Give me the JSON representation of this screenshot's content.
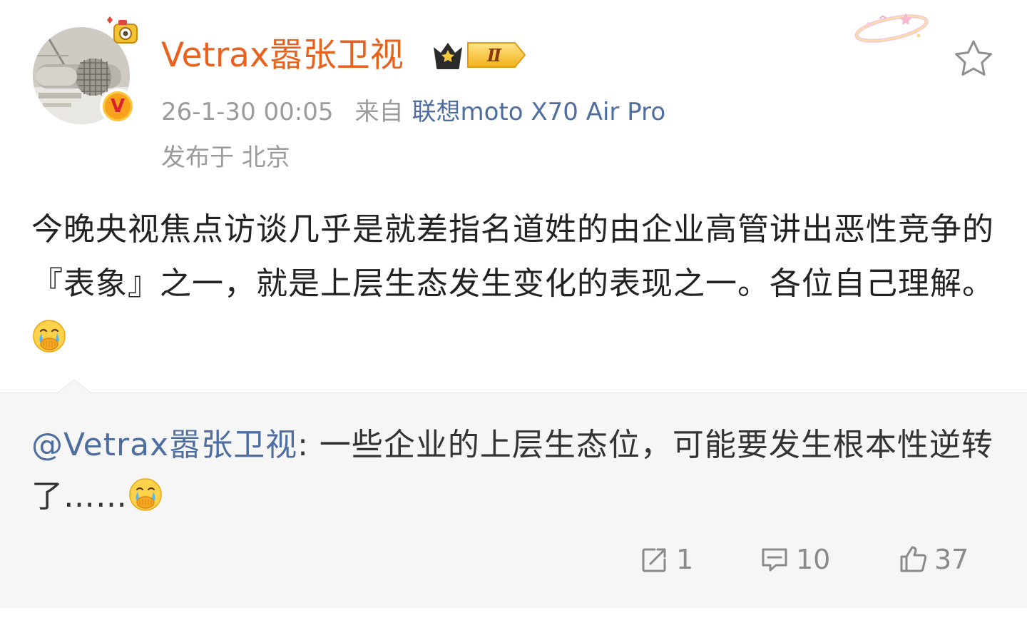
{
  "post": {
    "author": "Vetrax嚣张卫视",
    "member_level": "Ⅱ",
    "timestamp": "26-1-30 00:05",
    "source_label": "来自",
    "device": "联想moto X70 Air Pro",
    "location": "发布于 北京",
    "text": "今晚央视焦点访谈几乎是就差指名道姓的由企业高管讲出恶性竞争的『表象』之一，就是上层生态发生变化的表现之一。各位自己理解。",
    "emoji": "cry-cover-mouth-emoji"
  },
  "retweet": {
    "author": "@Vetrax嚣张卫视",
    "separator": ":",
    "text": " 一些企业的上层生态位，可能要发生根本性逆转了……",
    "emoji": "cry-cover-mouth-emoji"
  },
  "actions": {
    "repost_count": "1",
    "comment_count": "10",
    "like_count": "37"
  },
  "colors": {
    "username": "#e8611d",
    "link": "#4e6ea0",
    "meta": "#9b9b9b",
    "retweet_bg": "#f6f6f6"
  },
  "icons": [
    "star-icon",
    "repost-icon",
    "comment-icon",
    "like-icon",
    "verified-icon",
    "crown-badge-icon"
  ]
}
